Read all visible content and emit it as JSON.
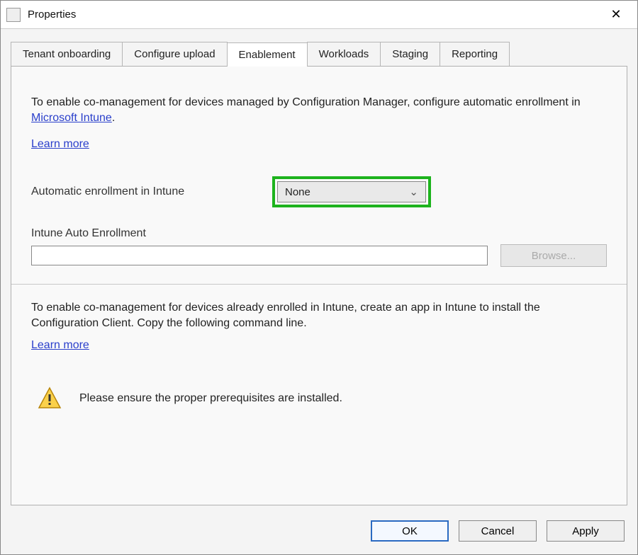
{
  "window": {
    "title": "Properties"
  },
  "tabs": [
    {
      "label": "Tenant onboarding",
      "active": false
    },
    {
      "label": "Configure upload",
      "active": false
    },
    {
      "label": "Enablement",
      "active": true
    },
    {
      "label": "Workloads",
      "active": false
    },
    {
      "label": "Staging",
      "active": false
    },
    {
      "label": "Reporting",
      "active": false
    }
  ],
  "enablement": {
    "desc_part1": "To enable co-management for devices managed by Configuration Manager, configure automatic enrollment in ",
    "intune_link": "Microsoft Intune",
    "desc_part2": ".",
    "learn_more": "Learn more",
    "auto_enroll_label": "Automatic enrollment in Intune",
    "auto_enroll_value": "None",
    "intune_auto_label": "Intune Auto Enrollment",
    "intune_auto_value": "",
    "browse_label": "Browse...",
    "desc2": "To enable co-management for devices already enrolled in Intune, create an app in Intune to install the Configuration Client. Copy the following command line.",
    "learn_more2": "Learn more",
    "warning_text": "Please ensure the proper prerequisites are installed."
  },
  "buttons": {
    "ok": "OK",
    "cancel": "Cancel",
    "apply": "Apply"
  }
}
